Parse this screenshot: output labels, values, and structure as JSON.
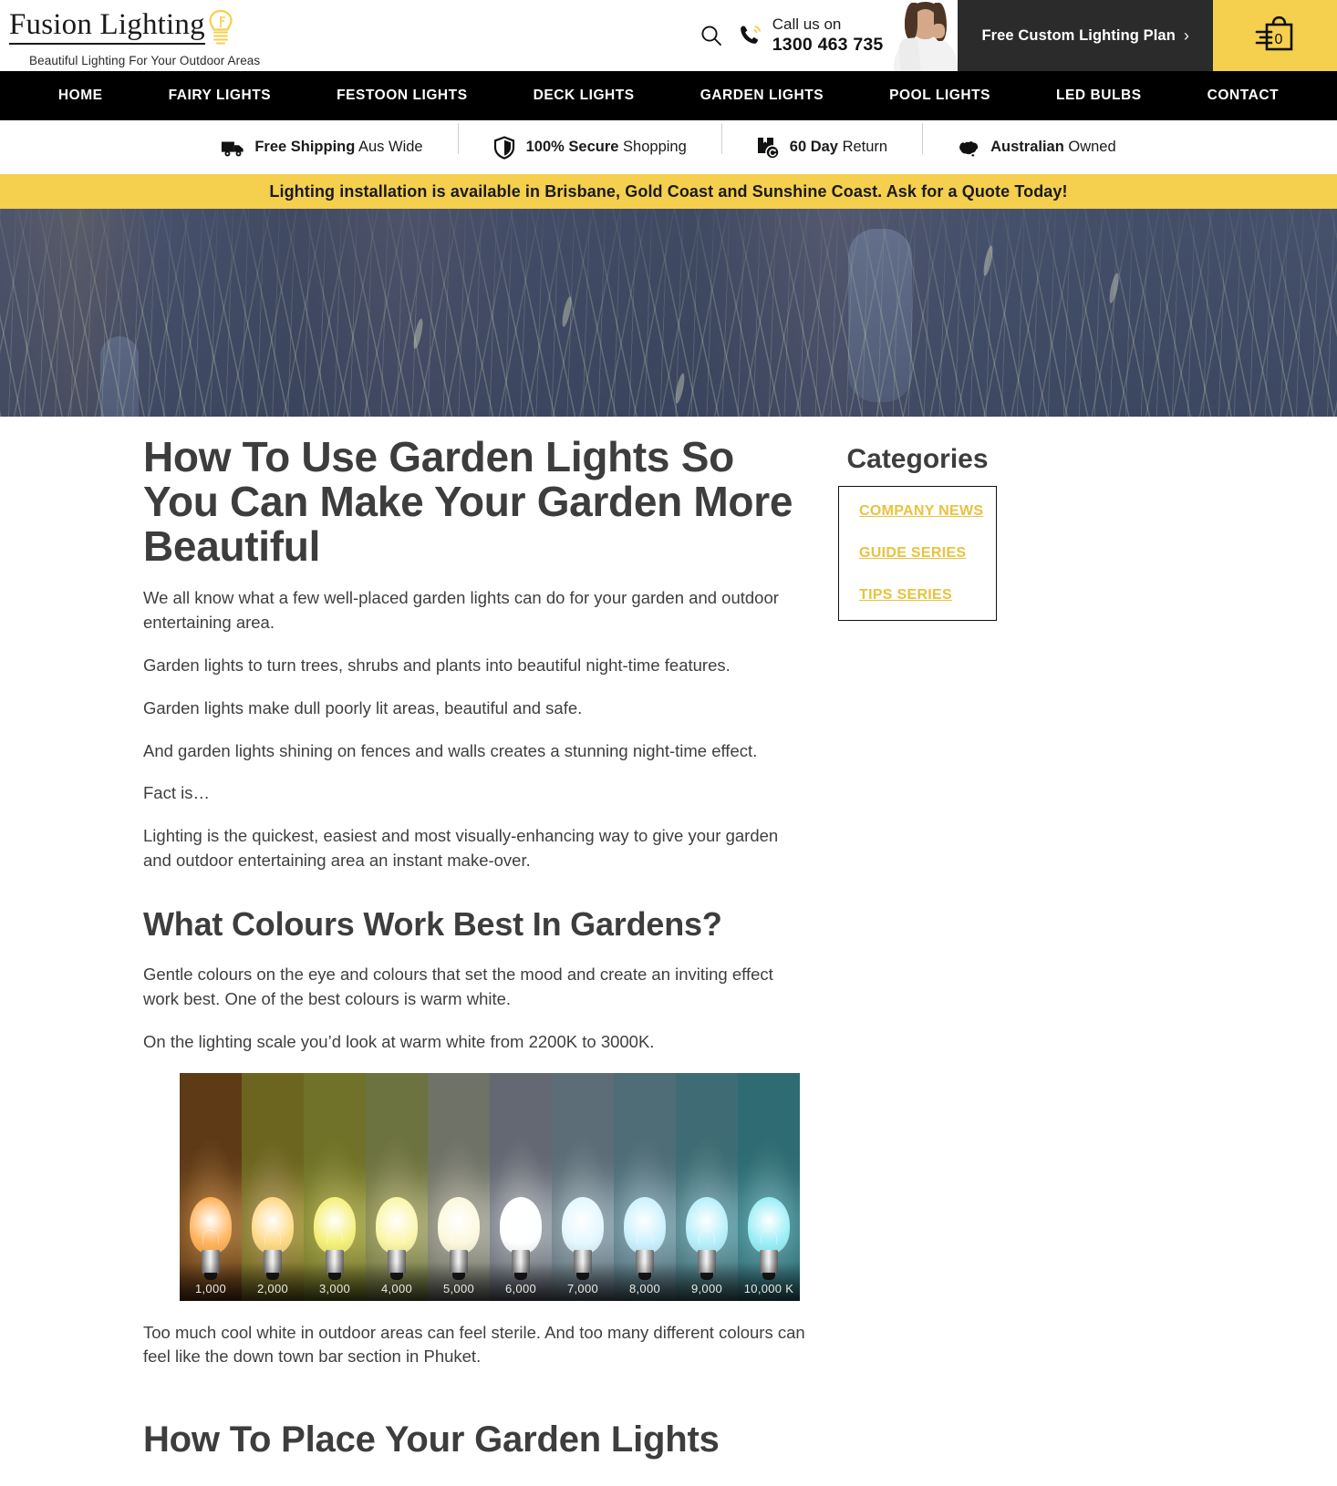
{
  "header": {
    "logo": {
      "title": "Fusion Lighting",
      "tagline": "Beautiful Lighting For Your Outdoor Areas",
      "bulb_icon": "lightbulb-icon"
    },
    "search_icon": "search-icon",
    "phone": {
      "icon": "phone-icon",
      "label": "Call us on",
      "number": "1300 463 735"
    },
    "agent_photo_alt": "support-agent-photo",
    "cta": {
      "label": "Free Custom Lighting Plan",
      "chevron": "›"
    },
    "cart": {
      "icon": "shopping-bag-icon",
      "count": "0"
    }
  },
  "nav": {
    "items": [
      {
        "label": "HOME"
      },
      {
        "label": "FAIRY LIGHTS"
      },
      {
        "label": "FESTOON LIGHTS"
      },
      {
        "label": "DECK LIGHTS"
      },
      {
        "label": "GARDEN LIGHTS"
      },
      {
        "label": "POOL LIGHTS"
      },
      {
        "label": "LED BULBS"
      },
      {
        "label": "CONTACT"
      }
    ]
  },
  "trust_bar": {
    "items": [
      {
        "icon": "truck-icon",
        "strong": "Free Shipping",
        "rest": " Aus Wide"
      },
      {
        "icon": "shield-icon",
        "strong": "100% Secure",
        "rest": " Shopping"
      },
      {
        "icon": "return-box-icon",
        "strong": "60 Day",
        "rest": " Return"
      },
      {
        "icon": "australia-map-icon",
        "strong": "Australian",
        "rest": " Owned"
      }
    ]
  },
  "promo": {
    "text": "Lighting installation is available in Brisbane, Gold Coast and Sunshine Coast.  Ask for a Quote Today!"
  },
  "article": {
    "title": "How To Use Garden Lights So You Can Make Your Garden More Beautiful",
    "p1": "We all know what a few well-placed garden lights can do for your garden and outdoor entertaining area.",
    "p2": "Garden lights to turn trees, shrubs and plants into beautiful night-time features.",
    "p3": "Garden lights make dull poorly lit areas, beautiful and safe.",
    "p4": "And garden lights shining on fences and walls creates a stunning night-time effect.",
    "p5": "Fact is…",
    "p6": "Lighting is the quickest, easiest and most visually-enhancing way to give your garden and outdoor entertaining area an instant make-over.",
    "h2_colours": "What Colours Work Best In Gardens?",
    "p7": "Gentle colours on the eye and colours that set the mood and create an inviting effect work best. One of the best colours is warm white.",
    "p8": "On the lighting scale you’d look at warm white from 2200K to 3000K.",
    "p9": "Too much cool white in outdoor areas can feel sterile. And too many different colours can feel like the down town bar section in Phuket.",
    "h2_place": "How To Place Your Garden Lights"
  },
  "kelvin_scale": {
    "alt": "colour-temperature-scale-image",
    "labels": [
      "1,000",
      "2,000",
      "3,000",
      "4,000",
      "5,000",
      "6,000",
      "7,000",
      "8,000",
      "9,000",
      "10,000 K"
    ],
    "bg_colors": [
      "#5e3a17",
      "#6b6520",
      "#6f7228",
      "#6d7340",
      "#6f7267",
      "#636873",
      "#5d6d77",
      "#4f6d76",
      "#3f6c74",
      "#2f6b72"
    ],
    "glow_colors": [
      "#ffb35c",
      "#ffd98a",
      "#f6f07a",
      "#fbf6a8",
      "#fcf8dc",
      "#ffffff",
      "#e4f8ff",
      "#cdf2ff",
      "#b9f0fb",
      "#9ceef6"
    ]
  },
  "sidebar": {
    "title": "Categories",
    "links": [
      {
        "label": "COMPANY NEWS"
      },
      {
        "label": "GUIDE SERIES"
      },
      {
        "label": "TIPS SERIES"
      }
    ]
  },
  "colors": {
    "brand_yellow": "#f5cf4e",
    "link_yellow": "#e8c23f",
    "dark": "#2b2b2b",
    "black": "#000000",
    "text": "#3f3f3f"
  }
}
